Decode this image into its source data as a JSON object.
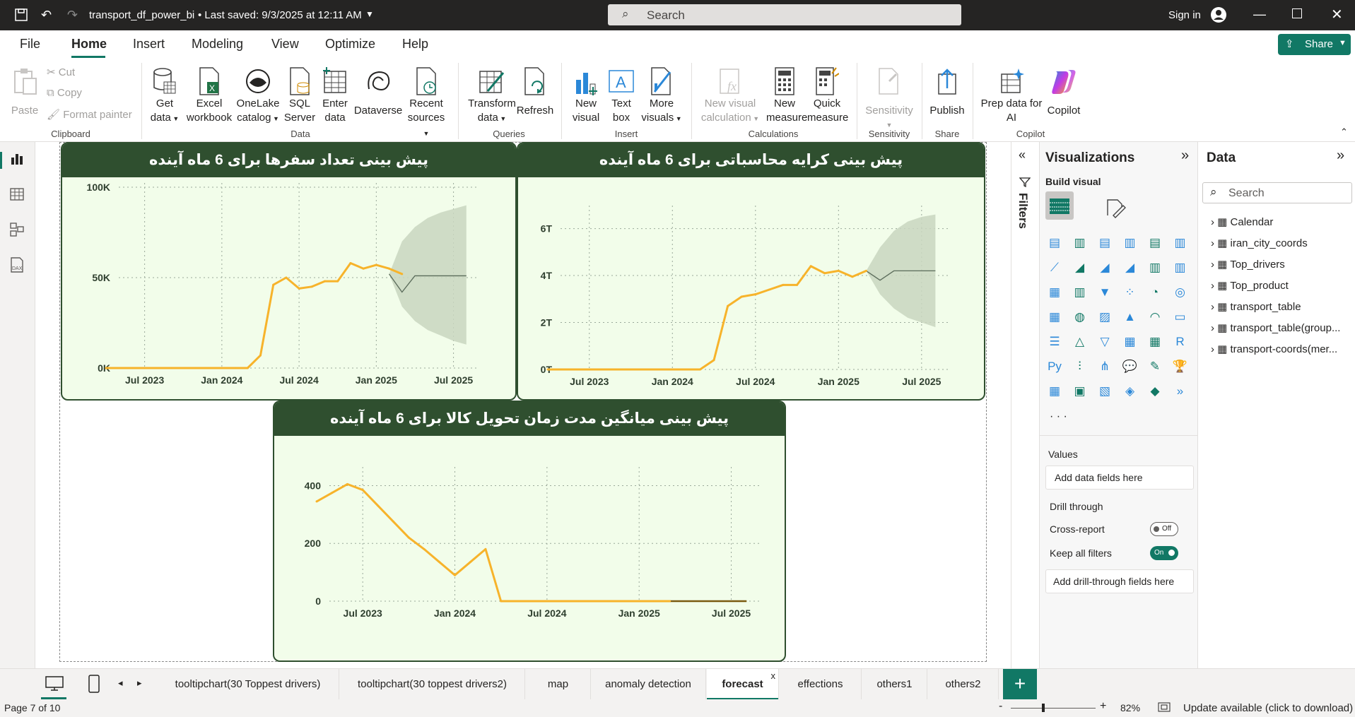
{
  "app": {
    "file_title": "transport_df_power_bi",
    "saved": "• Last saved: 9/3/2025 at 12:11 AM",
    "search_placeholder": "Search",
    "sign_in": "Sign in",
    "share": "Share"
  },
  "ribbon_tabs": [
    "File",
    "Home",
    "Insert",
    "Modeling",
    "View",
    "Optimize",
    "Help"
  ],
  "ribbon": {
    "paste": "Paste",
    "cut": "Cut",
    "copy": "Copy",
    "format_painter": "Format painter",
    "get_data": [
      "Get",
      "data"
    ],
    "excel": [
      "Excel",
      "workbook"
    ],
    "onelake": [
      "OneLake",
      "catalog"
    ],
    "sql": [
      "SQL",
      "Server"
    ],
    "enter": [
      "Enter",
      "data"
    ],
    "dataverse": "Dataverse",
    "recent": [
      "Recent",
      "sources"
    ],
    "transform": [
      "Transform",
      "data"
    ],
    "refresh": "Refresh",
    "new_visual": [
      "New",
      "visual"
    ],
    "text_box": [
      "Text",
      "box"
    ],
    "more_visuals": [
      "More",
      "visuals"
    ],
    "new_visual_calc": [
      "New visual",
      "calculation"
    ],
    "new_measure": [
      "New",
      "measure"
    ],
    "quick_measure": [
      "Quick",
      "measure"
    ],
    "sensitivity": "Sensitivity",
    "publish": "Publish",
    "prep_ai": [
      "Prep data for",
      "AI"
    ],
    "copilot": "Copilot",
    "groups": {
      "clipboard": "Clipboard",
      "data": "Data",
      "queries": "Queries",
      "insert": "Insert",
      "calculations": "Calculations",
      "sensitivity": "Sensitivity",
      "share": "Share",
      "copilot": "Copilot"
    }
  },
  "charts": {
    "trips": {
      "title": "پیش بینی تعداد سفرها برای 6 ماه آینده"
    },
    "fare": {
      "title": "پیش بینی کرایه محاسباتی برای 6 ماه آینده"
    },
    "delivery": {
      "title": "پیش بینی میانگین مدت زمان تحویل کالا برای 6 ماه آینده"
    }
  },
  "chart_data": [
    {
      "type": "line",
      "title": "پیش بینی تعداد سفرها برای 6 ماه آینده",
      "x_ticks": [
        "Jul 2023",
        "Jan 2024",
        "Jul 2024",
        "Jan 2025",
        "Jul 2025"
      ],
      "y_ticks": [
        "0K",
        "50K",
        "100K"
      ],
      "ylim": [
        0,
        100000
      ],
      "x": [
        "2023-04",
        "2023-05",
        "2023-06",
        "2023-07",
        "2023-08",
        "2023-09",
        "2023-10",
        "2023-11",
        "2023-12",
        "2024-01",
        "2024-02",
        "2024-03",
        "2024-04",
        "2024-05",
        "2024-06",
        "2024-07",
        "2024-08",
        "2024-09",
        "2024-10",
        "2024-11",
        "2024-12",
        "2025-01",
        "2025-02",
        "2025-03"
      ],
      "values": [
        0,
        0,
        0,
        0,
        0,
        0,
        0,
        0,
        0,
        0,
        0,
        0,
        7000,
        46000,
        50000,
        44000,
        45000,
        48000,
        48000,
        58000,
        55000,
        57000,
        55000,
        52000
      ],
      "forecast": {
        "x": [
          "2025-02",
          "2025-03",
          "2025-04",
          "2025-05",
          "2025-06",
          "2025-07",
          "2025-08"
        ],
        "values": [
          52000,
          42000,
          51000,
          51000,
          51000,
          51000,
          51000
        ],
        "upper": [
          52000,
          70000,
          78000,
          83000,
          86000,
          88000,
          90000
        ],
        "lower": [
          52000,
          34000,
          26000,
          21000,
          18000,
          15000,
          13000
        ]
      }
    },
    {
      "type": "line",
      "title": "پیش بینی کرایه محاسباتی برای 6 ماه آینده",
      "x_ticks": [
        "Jul 2023",
        "Jan 2024",
        "Jul 2024",
        "Jan 2025",
        "Jul 2025"
      ],
      "y_ticks": [
        "0T",
        "2T",
        "4T",
        "6T"
      ],
      "ylim": [
        0,
        6.8
      ],
      "x": [
        "2023-04",
        "2023-05",
        "2023-06",
        "2023-07",
        "2023-08",
        "2023-09",
        "2023-10",
        "2023-11",
        "2023-12",
        "2024-01",
        "2024-02",
        "2024-03",
        "2024-04",
        "2024-05",
        "2024-06",
        "2024-07",
        "2024-08",
        "2024-09",
        "2024-10",
        "2024-11",
        "2024-12",
        "2025-01",
        "2025-02",
        "2025-03"
      ],
      "values": [
        0,
        0,
        0,
        0,
        0,
        0,
        0,
        0,
        0,
        0,
        0,
        0,
        0.4,
        2.7,
        3.1,
        3.2,
        3.4,
        3.6,
        3.6,
        4.4,
        4.1,
        4.2,
        3.95,
        4.2
      ],
      "forecast": {
        "x": [
          "2025-03",
          "2025-04",
          "2025-05",
          "2025-06",
          "2025-07",
          "2025-08"
        ],
        "values": [
          4.2,
          3.8,
          4.2,
          4.2,
          4.2,
          4.2
        ],
        "upper": [
          4.2,
          5.2,
          5.9,
          6.3,
          6.5,
          6.6
        ],
        "lower": [
          4.2,
          3.2,
          2.6,
          2.2,
          2.0,
          1.8
        ]
      }
    },
    {
      "type": "line",
      "title": "پیش بینی میانگین مدت زمان تحویل کالا برای 6 ماه آینده",
      "x_ticks": [
        "Jul 2023",
        "Jan 2024",
        "Jul 2024",
        "Jan 2025",
        "Jul 2025"
      ],
      "y_ticks": [
        "0",
        "200",
        "400"
      ],
      "ylim": [
        0,
        450
      ],
      "x": [
        "2023-04",
        "2023-05",
        "2023-06",
        "2023-07",
        "2023-08",
        "2023-09",
        "2023-10",
        "2023-11",
        "2023-12",
        "2024-01",
        "2024-02",
        "2024-03",
        "2024-04",
        "2024-05",
        "2024-06",
        "2024-07",
        "2024-08",
        "2024-09",
        "2024-10",
        "2024-11",
        "2024-12",
        "2025-01",
        "2025-02",
        "2025-03"
      ],
      "values": [
        345,
        375,
        405,
        385,
        330,
        275,
        220,
        180,
        135,
        90,
        135,
        180,
        0,
        0,
        0,
        0,
        0,
        0,
        0,
        0,
        0,
        0,
        0,
        0
      ],
      "forecast": {
        "x": [
          "2025-03",
          "2025-08"
        ],
        "values": [
          0,
          0
        ]
      }
    }
  ],
  "visualizations": {
    "title": "Visualizations",
    "build_visual": "Build visual",
    "values_label": "Values",
    "values_placeholder": "Add data fields here",
    "drill_through": "Drill through",
    "cross_report": "Cross-report",
    "cross_report_state": "Off",
    "keep_filters": "Keep all filters",
    "keep_filters_state": "On",
    "drill_placeholder": "Add drill-through fields here"
  },
  "filters_label": "Filters",
  "data_pane": {
    "title": "Data",
    "search_placeholder": "Search",
    "tables": [
      "Calendar",
      "iran_city_coords",
      "Top_drivers",
      "Top_product",
      "transport_table",
      "transport_table(group...",
      "transport-coords(mer..."
    ]
  },
  "page_tabs": [
    "tooltipchart(30 Toppest drivers)",
    "tooltipchart(30 toppest drivers2)",
    "map",
    "anomaly detection",
    "forecast",
    "effections",
    "others1",
    "others2"
  ],
  "status": {
    "page": "Page 7 of 10",
    "zoom": "82%",
    "update": "Update available (click to download)"
  }
}
